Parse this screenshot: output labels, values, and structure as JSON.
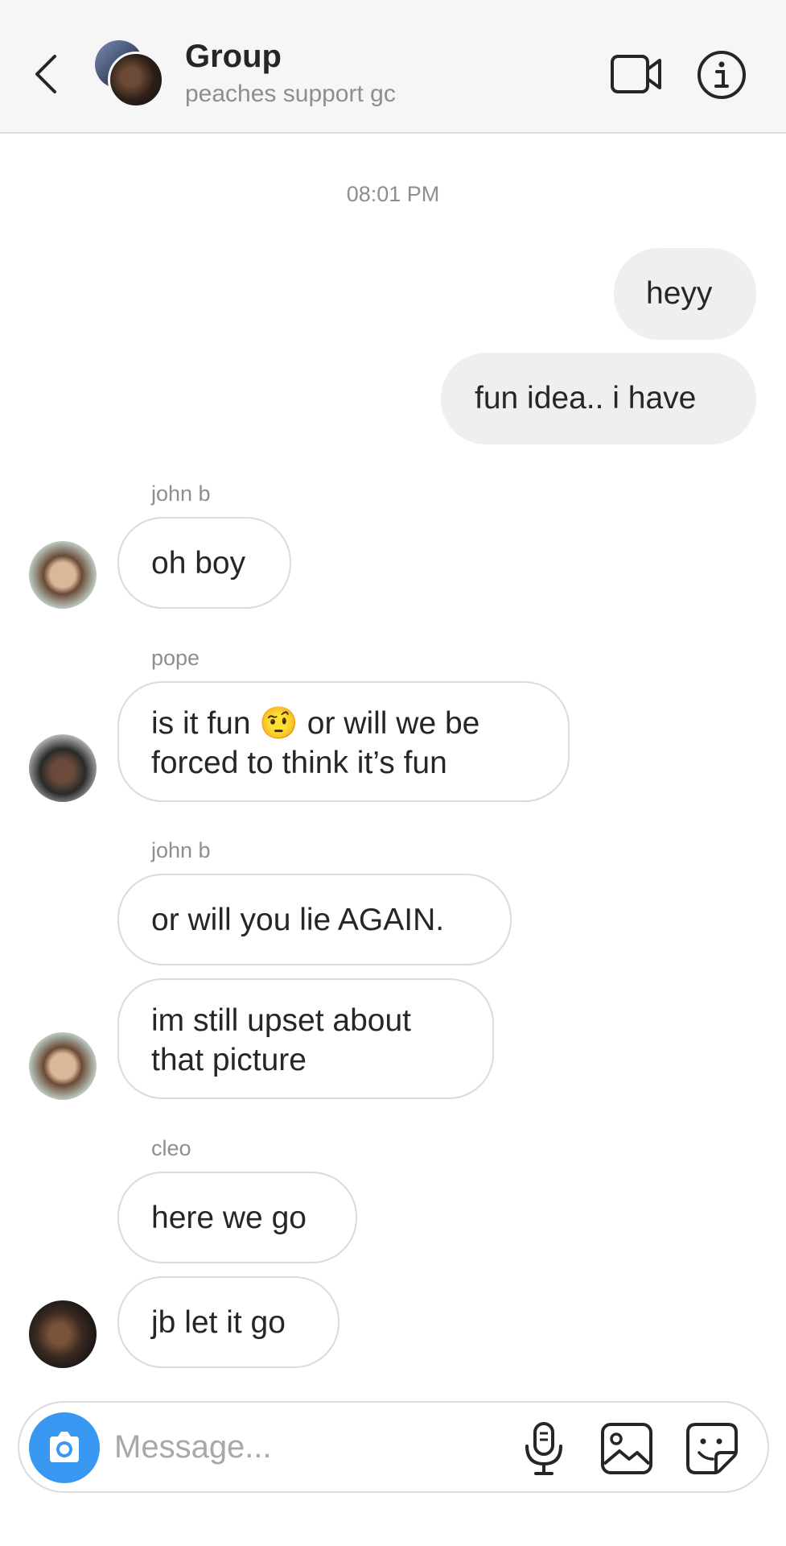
{
  "header": {
    "title": "Group",
    "subtitle": "peaches support gc"
  },
  "thread": {
    "timestamp": "08:01 PM",
    "outgoing": [
      {
        "text": "heyy"
      },
      {
        "text": "fun idea.. i have"
      }
    ],
    "groups": [
      {
        "sender": "john b",
        "messages": [
          "oh boy"
        ]
      },
      {
        "sender": "pope",
        "messages": [
          "is it fun 🤨 or will we be forced to think it’s fun"
        ],
        "lines": [
          "is it fun 🤨 or will we be",
          "forced to think it’s fun"
        ]
      },
      {
        "sender": "john b",
        "messages": [
          "or will you lie AGAIN.",
          "im still upset about that picture"
        ],
        "lines": [
          "im still upset about",
          "that picture"
        ]
      },
      {
        "sender": "cleo",
        "messages": [
          "here we go",
          "jb let it go"
        ]
      }
    ]
  },
  "composer": {
    "placeholder": "Message..."
  },
  "colors": {
    "accent": "#3897f0",
    "header_bg": "#f6f6f6",
    "outgoing_bubble": "#efefef",
    "incoming_border": "#dbdbdb",
    "secondary_text": "#8e8e8e"
  },
  "icons": [
    "chevron-left-icon",
    "video-camera-icon",
    "info-icon",
    "camera-icon",
    "microphone-icon",
    "gallery-icon",
    "sticker-icon"
  ]
}
